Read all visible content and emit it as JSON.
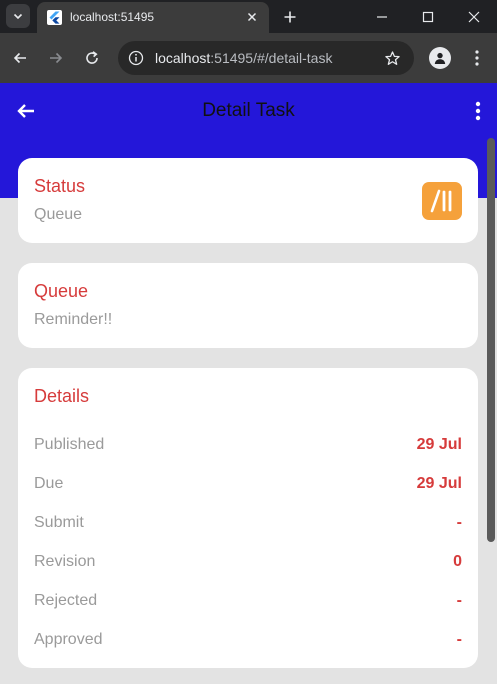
{
  "browser": {
    "tab_title": "localhost:51495",
    "url_host": "localhost",
    "url_rest": ":51495/#/detail-task"
  },
  "app": {
    "title": "Detail Task",
    "bar_color": "#2417d9",
    "accent_color": "#d63b3b"
  },
  "status_card": {
    "heading": "Status",
    "value": "Queue",
    "icon_name": "pause-slash-icon",
    "icon_color": "#f5a13b"
  },
  "queue_card": {
    "heading": "Queue",
    "value": "Reminder!!"
  },
  "details_card": {
    "heading": "Details",
    "rows": [
      {
        "label": "Published",
        "value": "29 Jul"
      },
      {
        "label": "Due",
        "value": "29 Jul"
      },
      {
        "label": "Submit",
        "value": "-"
      },
      {
        "label": "Revision",
        "value": "0"
      },
      {
        "label": "Rejected",
        "value": "-"
      },
      {
        "label": "Approved",
        "value": "-"
      }
    ]
  }
}
